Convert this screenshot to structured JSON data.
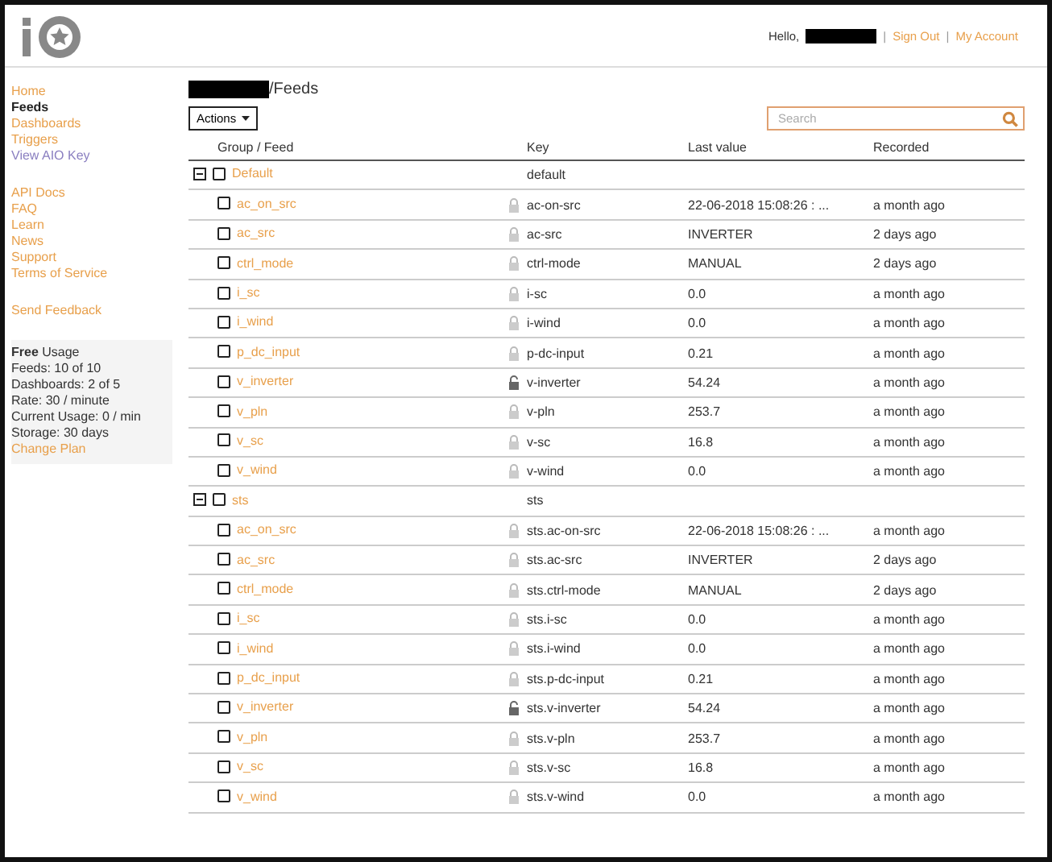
{
  "header": {
    "greeting": "Hello,",
    "separator": "|",
    "links": [
      "Sign Out",
      "My Account"
    ]
  },
  "sidebar": {
    "groups": [
      [
        {
          "label": "Home",
          "selected": false,
          "kind": "link"
        },
        {
          "label": "Feeds",
          "selected": true,
          "kind": "link"
        },
        {
          "label": "Dashboards",
          "selected": false,
          "kind": "link"
        },
        {
          "label": "Triggers",
          "selected": false,
          "kind": "link"
        },
        {
          "label": "View AIO Key",
          "selected": false,
          "kind": "key"
        }
      ],
      [
        {
          "label": "API Docs",
          "selected": false,
          "kind": "link"
        },
        {
          "label": "FAQ",
          "selected": false,
          "kind": "link"
        },
        {
          "label": "Learn",
          "selected": false,
          "kind": "link"
        },
        {
          "label": "News",
          "selected": false,
          "kind": "link"
        },
        {
          "label": "Support",
          "selected": false,
          "kind": "link"
        },
        {
          "label": "Terms of Service",
          "selected": false,
          "kind": "link"
        }
      ],
      [
        {
          "label": "Send Feedback",
          "selected": false,
          "kind": "link"
        }
      ]
    ],
    "usage": {
      "title": "**Free** Usage",
      "lines": [
        "Feeds: 10 of 10",
        "Dashboards: 2 of 5",
        "Rate: 30 / minute",
        "Current Usage: 0 / min",
        "Storage: 30 days"
      ],
      "link": "Change Plan"
    }
  },
  "breadcrumb": "/Feeds",
  "actions_button": "Actions",
  "search": {
    "placeholder": "Search"
  },
  "table": {
    "columns": [
      "Group / Feed",
      "Key",
      "Last value",
      "Recorded"
    ],
    "groups": [
      {
        "name": "Default",
        "key": "default",
        "expanded": true,
        "checked": false,
        "children": [
          {
            "name": "ac_on_src",
            "locked": true,
            "checked": false,
            "key": "ac-on-src",
            "last_value": "22-06-2018 15:08:26 : ...",
            "recorded": "a month ago"
          },
          {
            "name": "ac_src",
            "locked": true,
            "checked": false,
            "key": "ac-src",
            "last_value": "INVERTER",
            "recorded": "2 days ago"
          },
          {
            "name": "ctrl_mode",
            "locked": true,
            "checked": false,
            "key": "ctrl-mode",
            "last_value": "MANUAL",
            "recorded": "2 days ago"
          },
          {
            "name": "i_sc",
            "locked": true,
            "checked": false,
            "key": "i-sc",
            "last_value": "0.0",
            "recorded": "a month ago"
          },
          {
            "name": "i_wind",
            "locked": true,
            "checked": false,
            "key": "i-wind",
            "last_value": "0.0",
            "recorded": "a month ago"
          },
          {
            "name": "p_dc_input",
            "locked": true,
            "checked": false,
            "key": "p-dc-input",
            "last_value": "0.21",
            "recorded": "a month ago"
          },
          {
            "name": "v_inverter",
            "locked": false,
            "checked": false,
            "key": "v-inverter",
            "last_value": "54.24",
            "recorded": "a month ago"
          },
          {
            "name": "v_pln",
            "locked": true,
            "checked": false,
            "key": "v-pln",
            "last_value": "253.7",
            "recorded": "a month ago"
          },
          {
            "name": "v_sc",
            "locked": true,
            "checked": false,
            "key": "v-sc",
            "last_value": "16.8",
            "recorded": "a month ago"
          },
          {
            "name": "v_wind",
            "locked": true,
            "checked": false,
            "key": "v-wind",
            "last_value": "0.0",
            "recorded": "a month ago"
          }
        ]
      },
      {
        "name": "sts",
        "key": "sts",
        "expanded": true,
        "checked": false,
        "children": [
          {
            "name": "ac_on_src",
            "locked": true,
            "checked": false,
            "key": "sts.ac-on-src",
            "last_value": "22-06-2018 15:08:26 : ...",
            "recorded": "a month ago"
          },
          {
            "name": "ac_src",
            "locked": true,
            "checked": false,
            "key": "sts.ac-src",
            "last_value": "INVERTER",
            "recorded": "2 days ago"
          },
          {
            "name": "ctrl_mode",
            "locked": true,
            "checked": false,
            "key": "sts.ctrl-mode",
            "last_value": "MANUAL",
            "recorded": "2 days ago"
          },
          {
            "name": "i_sc",
            "locked": true,
            "checked": false,
            "key": "sts.i-sc",
            "last_value": "0.0",
            "recorded": "a month ago"
          },
          {
            "name": "i_wind",
            "locked": true,
            "checked": false,
            "key": "sts.i-wind",
            "last_value": "0.0",
            "recorded": "a month ago"
          },
          {
            "name": "p_dc_input",
            "locked": true,
            "checked": false,
            "key": "sts.p-dc-input",
            "last_value": "0.21",
            "recorded": "a month ago"
          },
          {
            "name": "v_inverter",
            "locked": false,
            "checked": false,
            "key": "sts.v-inverter",
            "last_value": "54.24",
            "recorded": "a month ago"
          },
          {
            "name": "v_pln",
            "locked": true,
            "checked": false,
            "key": "sts.v-pln",
            "last_value": "253.7",
            "recorded": "a month ago"
          },
          {
            "name": "v_sc",
            "locked": true,
            "checked": false,
            "key": "sts.v-sc",
            "last_value": "16.8",
            "recorded": "a month ago"
          },
          {
            "name": "v_wind",
            "locked": true,
            "checked": false,
            "key": "sts.v-wind",
            "last_value": "0.0",
            "recorded": "a month ago"
          }
        ]
      }
    ]
  }
}
